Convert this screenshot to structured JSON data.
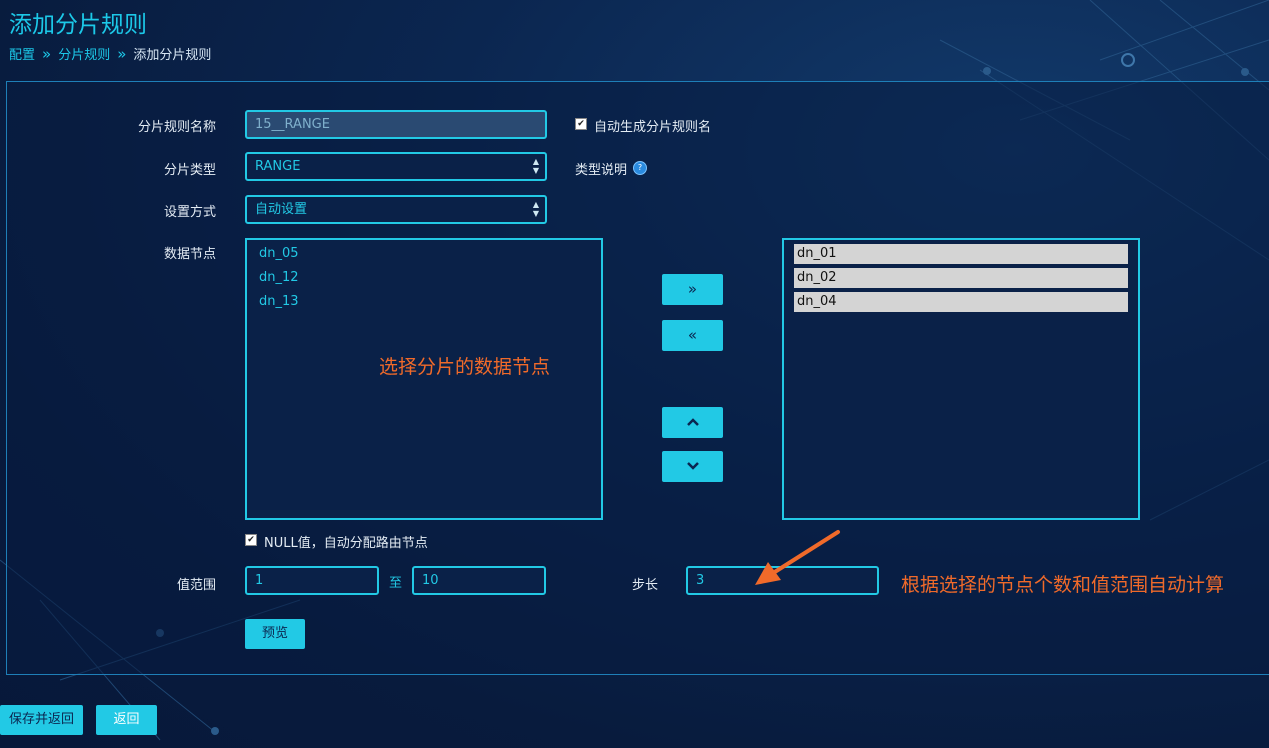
{
  "page": {
    "title": "添加分片规则",
    "breadcrumb": [
      "配置",
      "分片规则",
      "添加分片规则"
    ]
  },
  "form": {
    "rule_name": {
      "label": "分片规则名称",
      "value": "15__RANGE"
    },
    "auto_name": {
      "label": "自动生成分片规则名",
      "checked": true
    },
    "shard_type": {
      "label": "分片类型",
      "value": "RANGE"
    },
    "type_desc": {
      "label": "类型说明",
      "icon": "question-icon"
    },
    "setting_mode": {
      "label": "设置方式",
      "value": "自动设置"
    },
    "data_nodes": {
      "label": "数据节点",
      "available": [
        "dn_05",
        "dn_12",
        "dn_13"
      ],
      "selected": [
        "dn_01",
        "dn_02",
        "dn_04"
      ]
    },
    "null_value": {
      "label": "NULL值，自动分配路由节点",
      "checked": true
    },
    "value_range": {
      "label": "值范围",
      "from": "1",
      "to_label": "至",
      "to": "10"
    },
    "step": {
      "label": "步长",
      "value": "3"
    },
    "preview_button": "预览"
  },
  "transfer_buttons": {
    "add_all": "»",
    "remove_all": "«",
    "move_up": "⌃",
    "move_down": "⌄"
  },
  "annotations": {
    "select_nodes": "选择分片的数据节点",
    "auto_calc": "根据选择的节点个数和值范围自动计算"
  },
  "footer": {
    "save_button": "保存并返回",
    "back_button": "返回"
  },
  "colors": {
    "accent": "#22c9e5",
    "annotation": "#f06a2a",
    "background": "#0b2650"
  }
}
